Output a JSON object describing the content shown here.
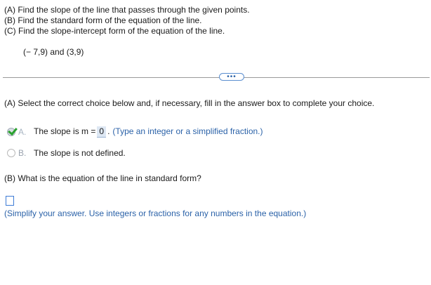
{
  "header": {
    "part_a": "(A) Find the slope of the line that passes through the given points.",
    "part_b": "(B) Find the standard form of the equation of the line.",
    "part_c": "(C) Find the slope-intercept form of the equation of the line.",
    "points": "(− 7,9) and (3,9)"
  },
  "more_button": {
    "label": "•••"
  },
  "question_a": {
    "instruction": "(A) Select the correct choice below and, if necessary, fill in the answer box to complete your choice.",
    "choice_a": {
      "letter": "A.",
      "prefix": "The slope is m =",
      "value": "0",
      "suffix": ".",
      "hint": "(Type an integer or a simplified fraction.)",
      "selected": true,
      "status": "correct"
    },
    "choice_b": {
      "letter": "B.",
      "text": "The slope is not defined.",
      "selected": false
    }
  },
  "question_b": {
    "prompt": "(B) What is the equation of the line in standard form?",
    "answer_value": "",
    "hint": "(Simplify your answer. Use integers or fractions for any numbers in the equation.)"
  },
  "colors": {
    "accent": "#2b62a8",
    "correct": "#2aa12e",
    "answer_highlight": "#dde7f3"
  }
}
